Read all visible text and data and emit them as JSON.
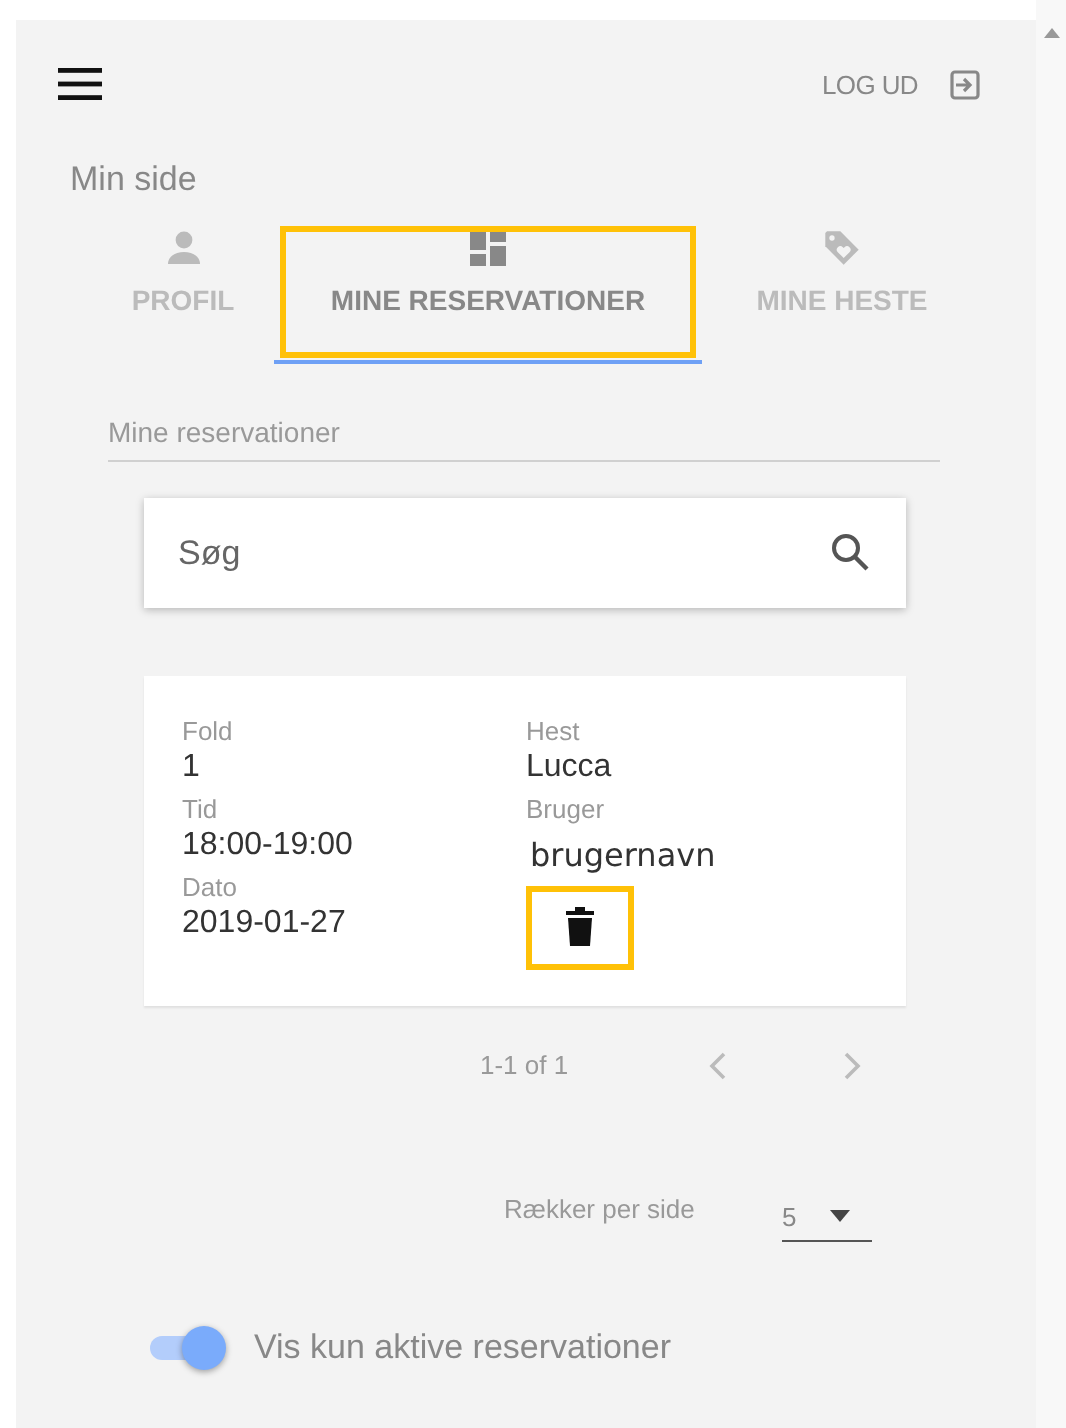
{
  "header": {
    "logout": "LOG UD"
  },
  "page_title": "Min side",
  "tabs": [
    {
      "label": "PROFIL",
      "kind": "person",
      "selected": false,
      "highlighted": false
    },
    {
      "label": "MINE RESERVATIONER",
      "kind": "dashboard",
      "selected": true,
      "highlighted": true
    },
    {
      "label": "MINE HESTE",
      "kind": "tag",
      "selected": false,
      "highlighted": false
    }
  ],
  "section_title": "Mine reservationer",
  "search": {
    "placeholder": "Søg"
  },
  "reservations": [
    {
      "fields_left": [
        {
          "label": "Fold",
          "value": "1"
        },
        {
          "label": "Tid",
          "value": "18:00-19:00"
        },
        {
          "label": "Dato",
          "value": "2019-01-27"
        }
      ],
      "fields_right": [
        {
          "label": "Hest",
          "value": "Lucca"
        },
        {
          "label": "Bruger",
          "value": "brugernavn"
        }
      ],
      "delete_highlighted": true
    }
  ],
  "pagination": {
    "range": "1-1 of 1",
    "rows_per_page_label": "Rækker per side",
    "rows_per_page": "5"
  },
  "active_toggle": {
    "label": "Vis kun aktive reservationer",
    "on": true
  }
}
